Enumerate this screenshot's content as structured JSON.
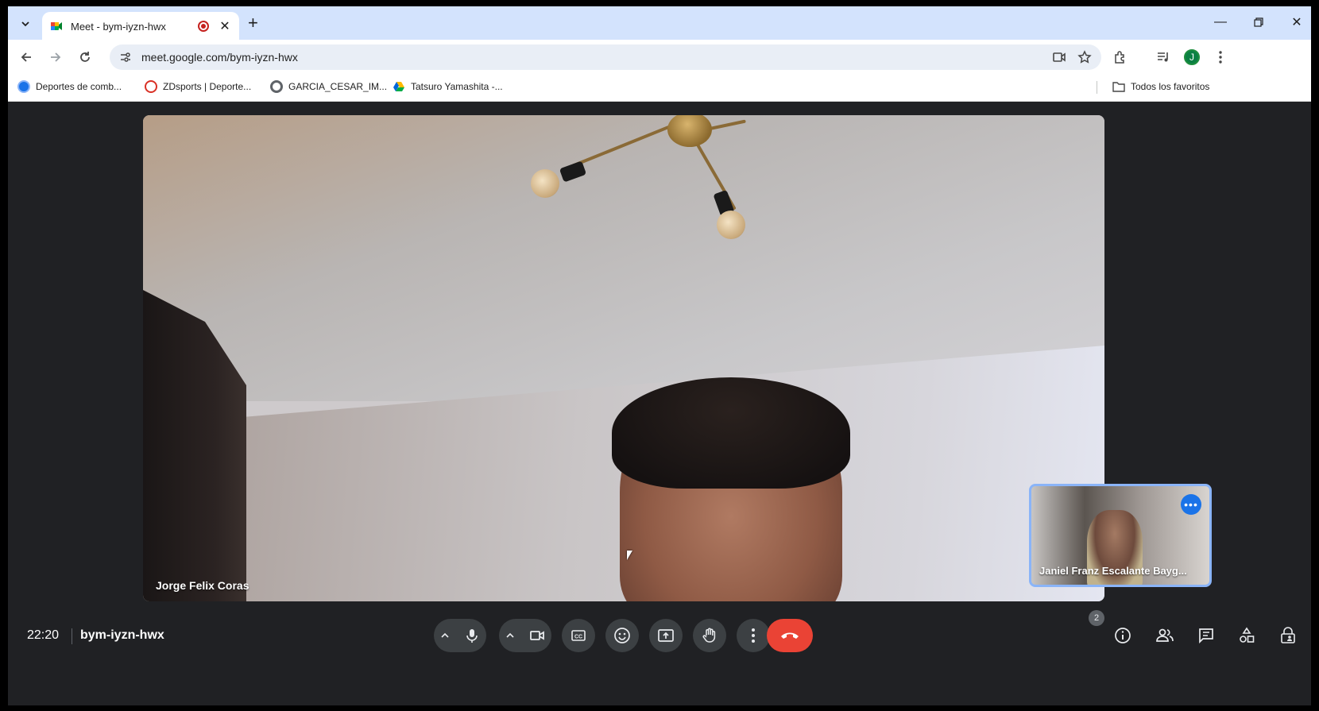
{
  "browser": {
    "tab": {
      "title": "Meet - bym-iyzn-hwx",
      "favicon": "google-meet-icon"
    },
    "url": "meet.google.com/bym-iyzn-hwx",
    "profile_initial": "J",
    "bookmarks": [
      {
        "label": "Deportes de comb...",
        "icon": "globe-icon"
      },
      {
        "label": "ZDsports | Deporte...",
        "icon": "zd-icon"
      },
      {
        "label": "GARCIA_CESAR_IM...",
        "icon": "chrome-icon"
      },
      {
        "label": "Tatsuro Yamashita -...",
        "icon": "drive-icon"
      }
    ],
    "all_bookmarks_label": "Todos los favoritos"
  },
  "meeting": {
    "main_participant": "Jorge Felix Coras",
    "pip_participant": "Janiel Franz Escalante Bayg...",
    "time": "22:20",
    "code": "bym-iyzn-hwx",
    "participant_count": "2",
    "colors": {
      "end_call": "#ea4335",
      "pip_border": "#8ab4f8",
      "bar": "#202124"
    }
  }
}
